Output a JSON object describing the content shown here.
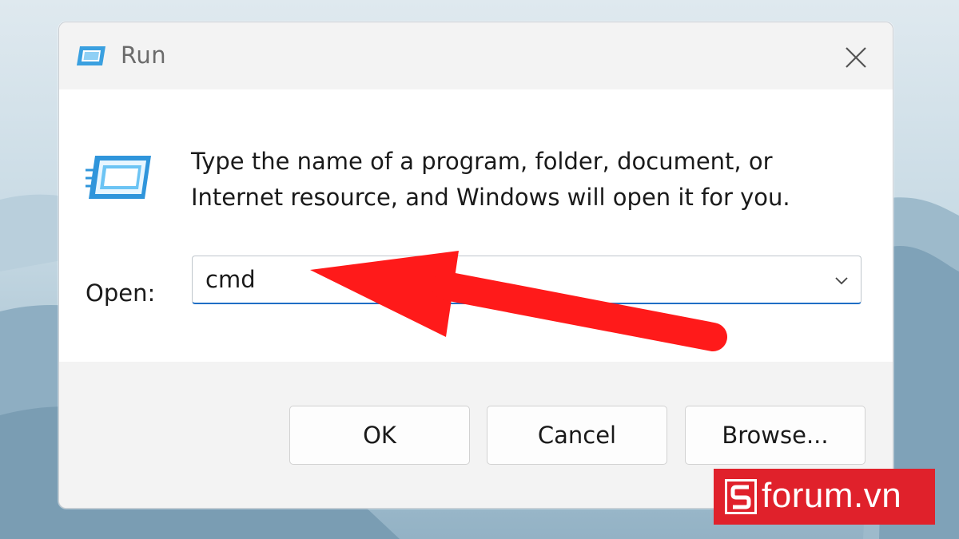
{
  "window": {
    "title": "Run",
    "icon": "run-app-icon",
    "close_icon": "close-icon"
  },
  "content": {
    "description": "Type the name of a program, folder, document, or Internet resource, and Windows will open it for you.",
    "open_label": "Open:",
    "open_value": "cmd",
    "dropdown_icon": "chevron-down-icon"
  },
  "buttons": {
    "ok": "OK",
    "cancel": "Cancel",
    "browse": "Browse..."
  },
  "watermark": {
    "text": "forum.vn",
    "logo": "sforum-logo-icon"
  },
  "colors": {
    "accent": "#1f6fc5",
    "arrow": "#ff1a1a",
    "badge": "#e0212b"
  }
}
